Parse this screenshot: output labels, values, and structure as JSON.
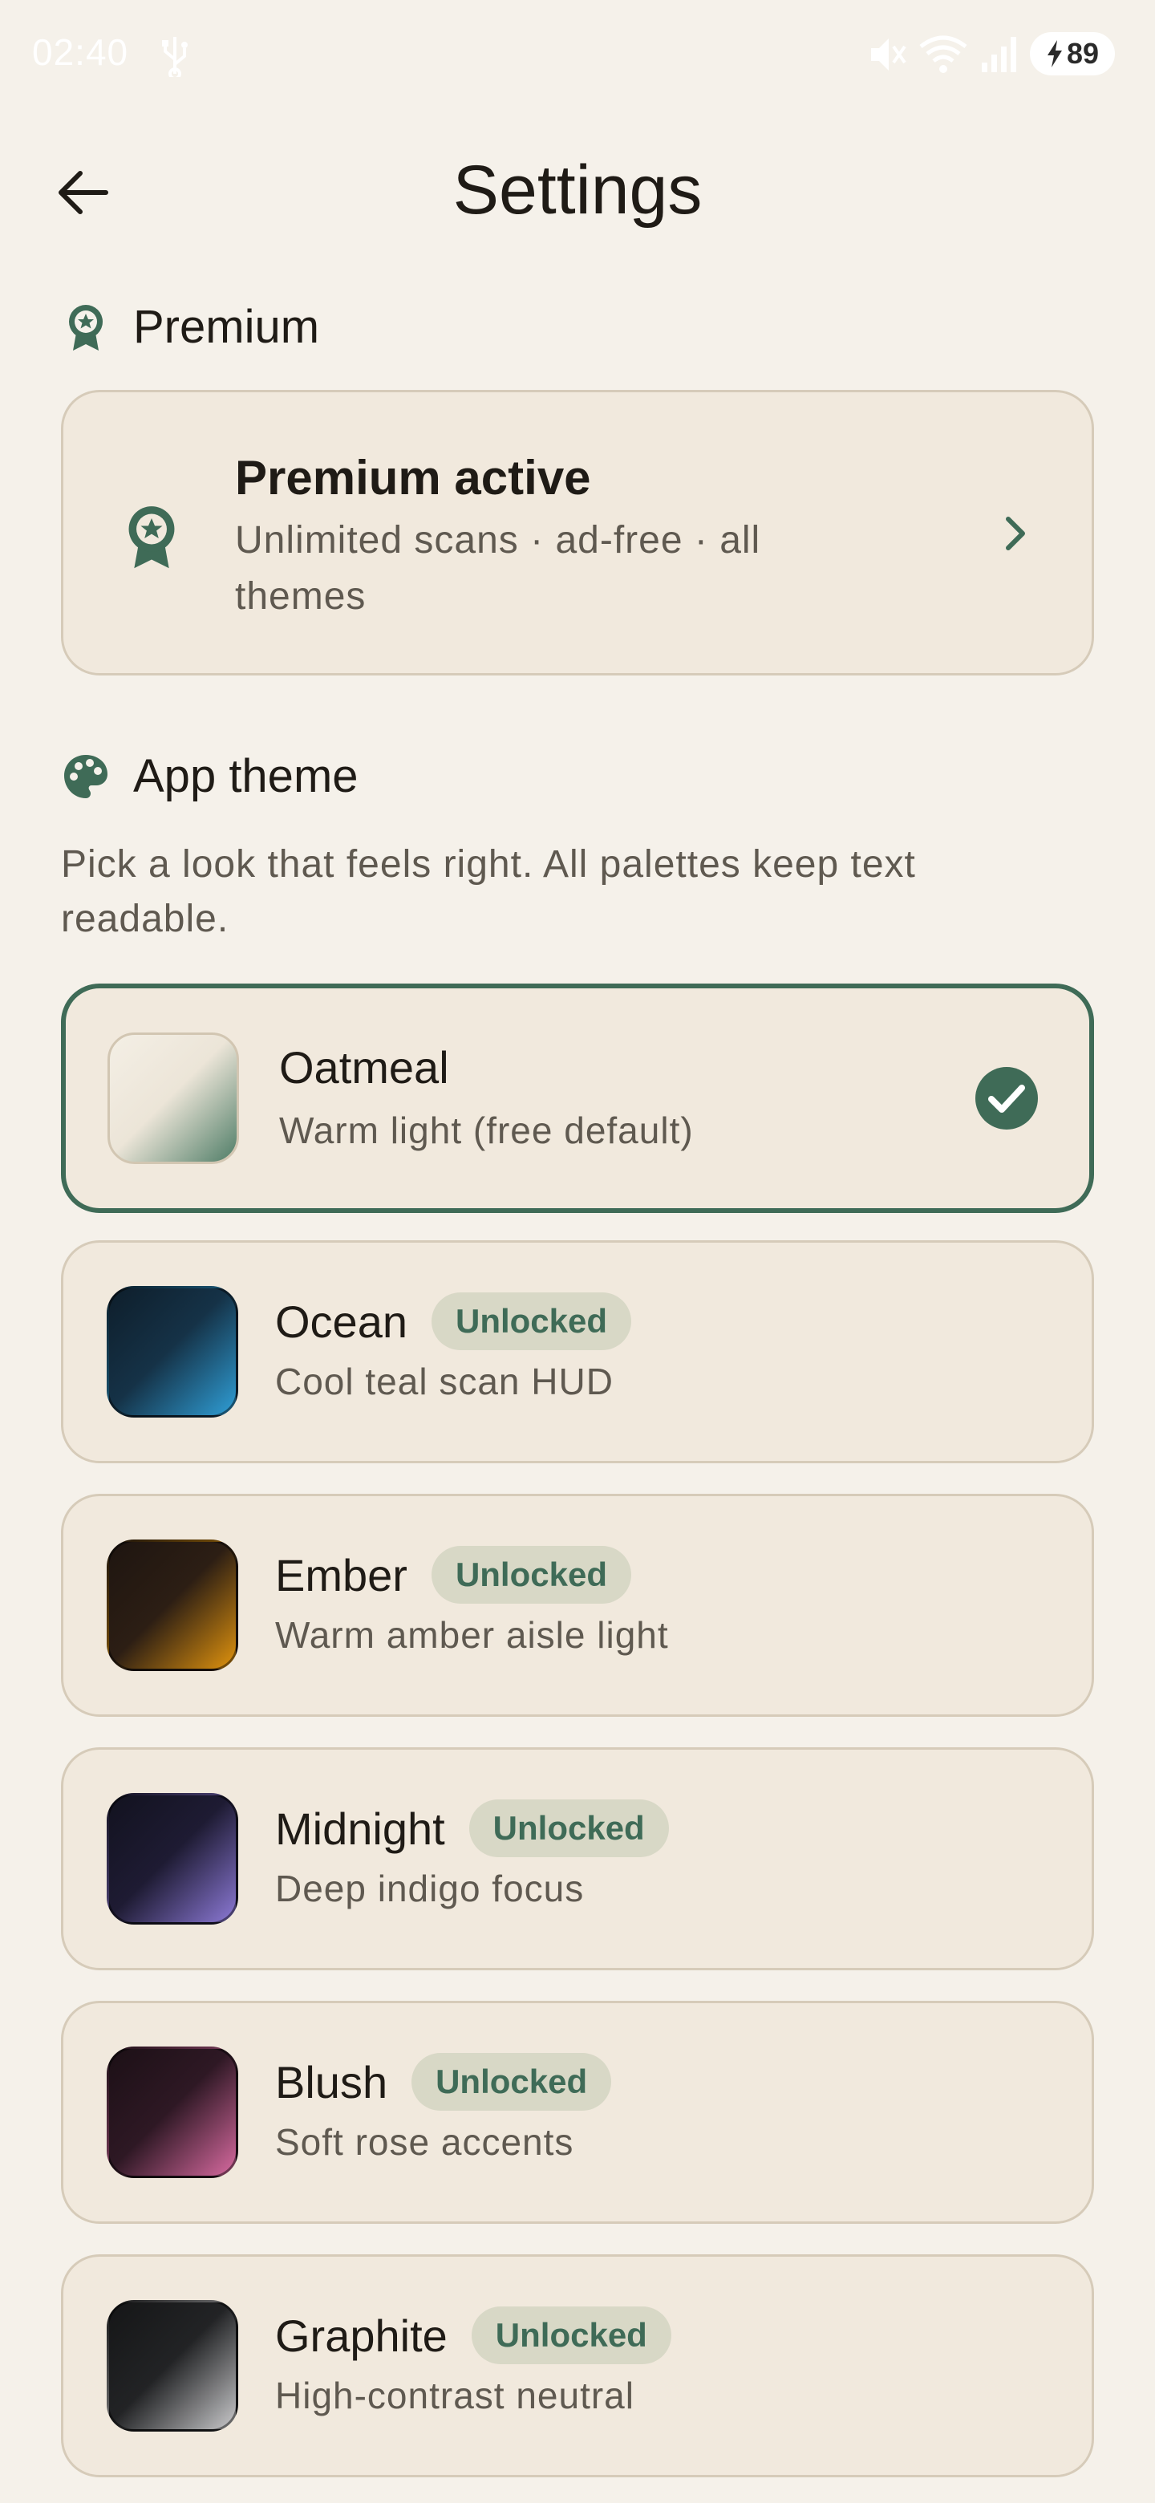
{
  "status_bar": {
    "time": "02:40",
    "battery": "89",
    "icons": [
      "usb-icon",
      "mute-icon",
      "wifi-icon",
      "signal-icon",
      "battery-charging-icon"
    ]
  },
  "appbar": {
    "title": "Settings",
    "back_icon": "arrow-back-icon"
  },
  "premium_section": {
    "header": "Premium",
    "icon": "award-badge-icon",
    "card": {
      "title": "Premium active",
      "subtitle": "Unlimited scans · ad-free · all themes",
      "chevron": "chevron-right-icon"
    }
  },
  "theme_section": {
    "header": "App theme",
    "icon": "palette-icon",
    "description": "Pick a look that feels right. All palettes keep text readable.",
    "themes": [
      {
        "name": "Oatmeal",
        "subtitle": "Warm light (free default)",
        "badge": "",
        "selected": true,
        "colors": [
          "#f4efe5",
          "#ece5d8",
          "#4f7d67"
        ]
      },
      {
        "name": "Ocean",
        "subtitle": "Cool teal scan HUD",
        "badge": "Unlocked",
        "selected": false,
        "colors": [
          "#0e1e2b",
          "#153247",
          "#2f9ed6"
        ]
      },
      {
        "name": "Ember",
        "subtitle": "Warm amber aisle light",
        "badge": "Unlocked",
        "selected": false,
        "colors": [
          "#1e1510",
          "#2c1e14",
          "#e0930e"
        ]
      },
      {
        "name": "Midnight",
        "subtitle": "Deep indigo focus",
        "badge": "Unlocked",
        "selected": false,
        "colors": [
          "#12121f",
          "#1e1b33",
          "#8c79d6"
        ]
      },
      {
        "name": "Blush",
        "subtitle": "Soft rose accents",
        "badge": "Unlocked",
        "selected": false,
        "colors": [
          "#1c1016",
          "#2e1824",
          "#d86aa0"
        ]
      },
      {
        "name": "Graphite",
        "subtitle": "High-contrast neutral",
        "badge": "Unlocked",
        "selected": false,
        "colors": [
          "#151617",
          "#222325",
          "#c9c9cb"
        ]
      }
    ]
  },
  "colors": {
    "background": "#f5f1ea",
    "card": "#f1e9dd",
    "card_border": "#d6cbb9",
    "accent": "#3f6b57",
    "badge_bg": "#d8d8c6",
    "text_primary": "#1f1b16",
    "text_secondary": "#5f5950"
  }
}
